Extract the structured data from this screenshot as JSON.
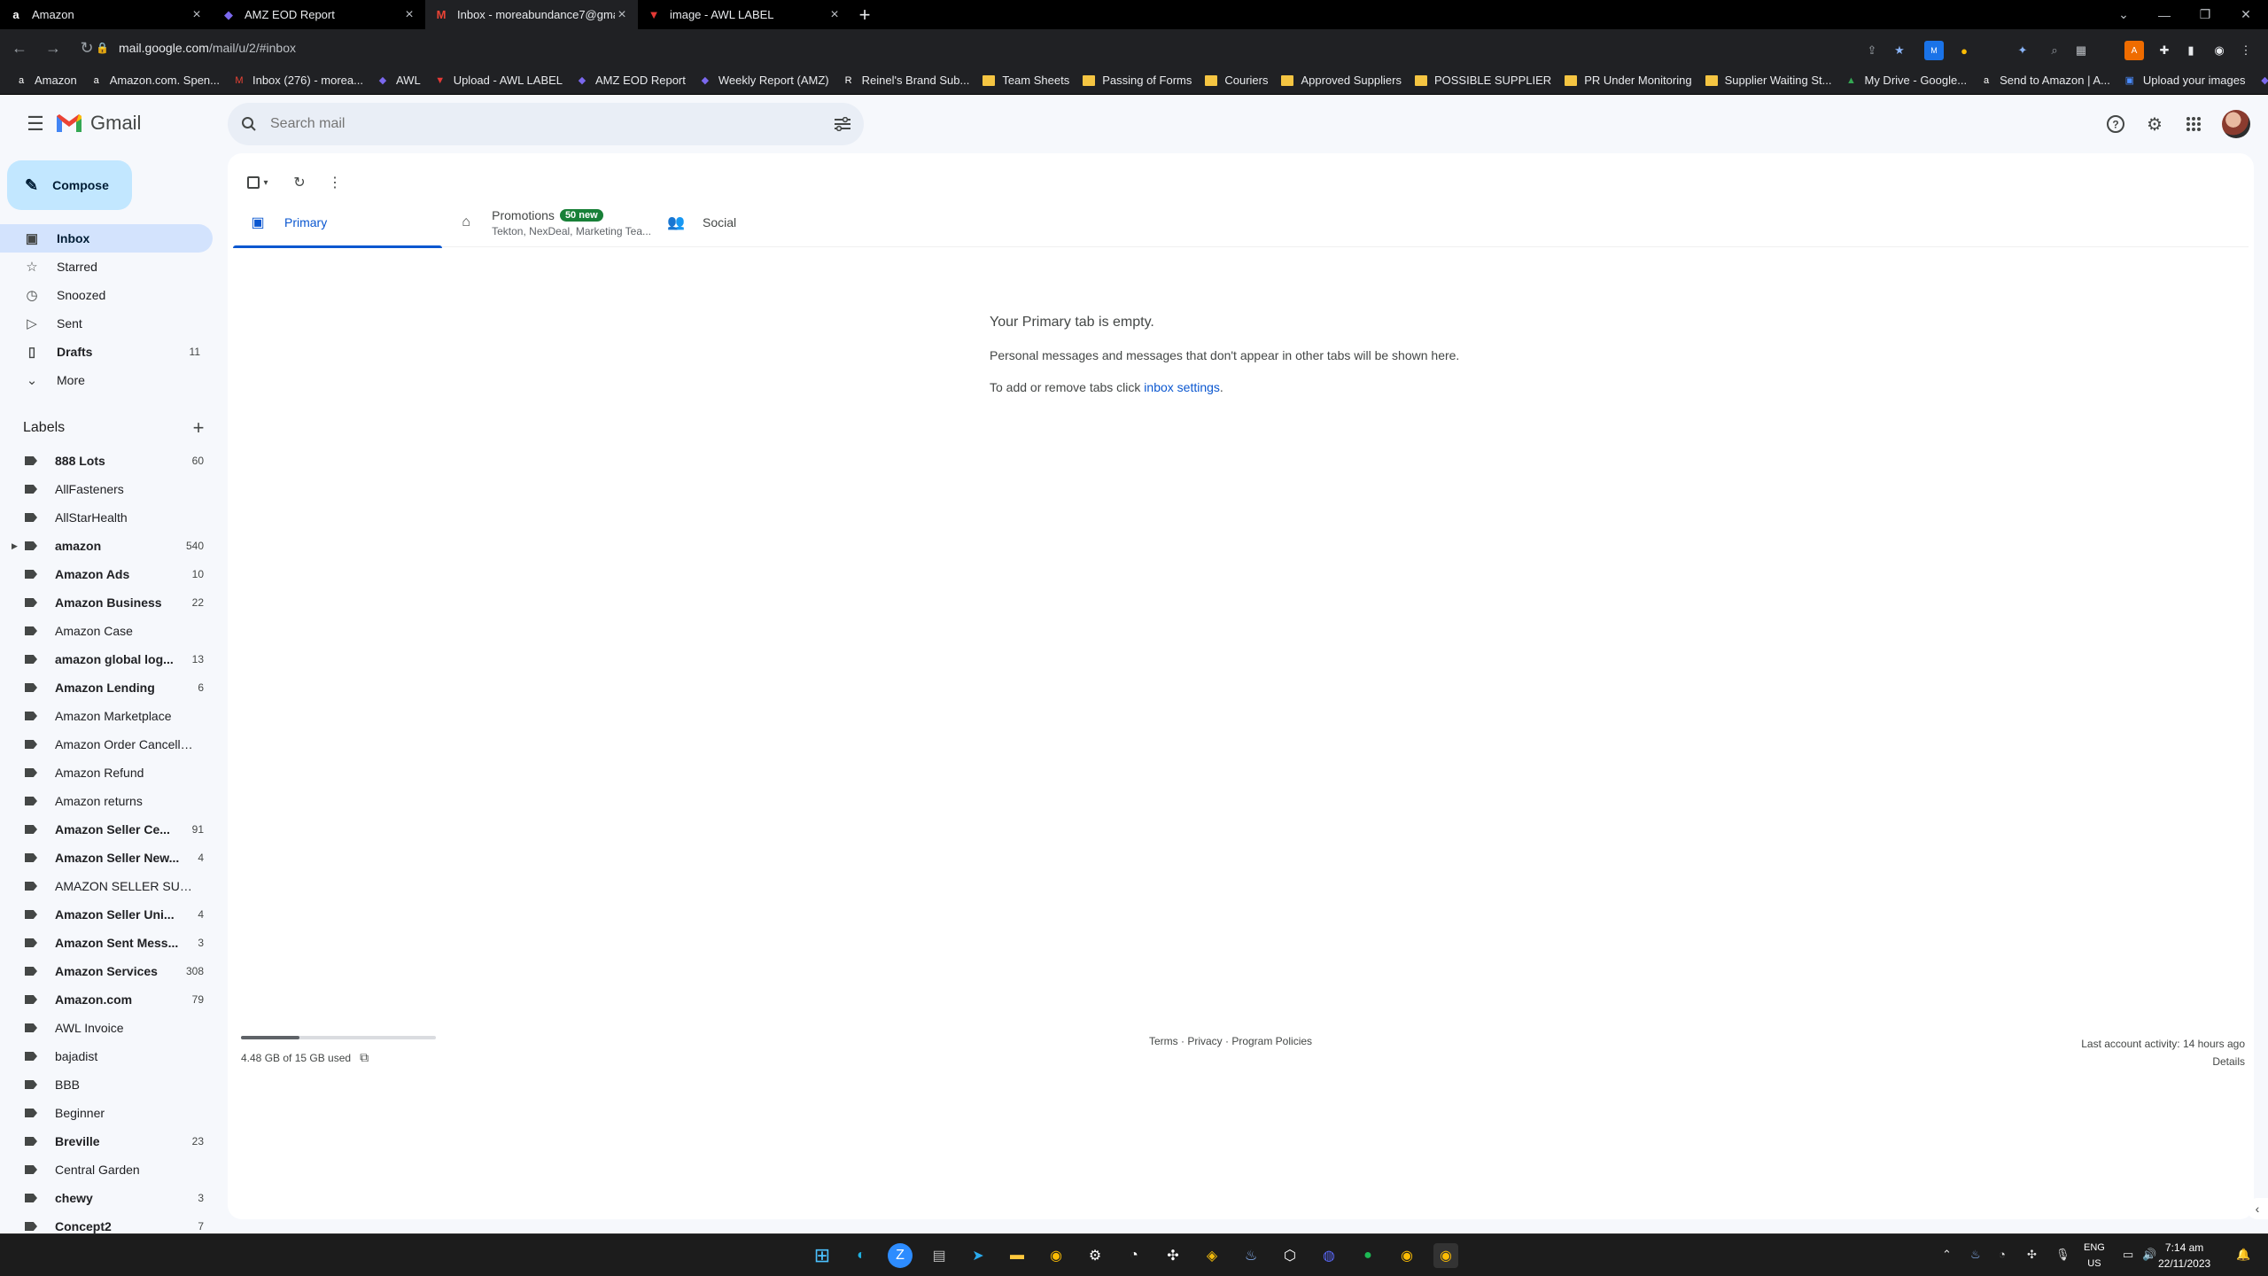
{
  "browser": {
    "tabs": [
      {
        "title": "Amazon",
        "icon": "amazon-icon"
      },
      {
        "title": "AMZ EOD Report",
        "icon": "clickup-icon"
      },
      {
        "title": "Inbox - moreabundance7@gma",
        "icon": "gmail-icon"
      },
      {
        "title": "image - AWL LABEL",
        "icon": "awl-icon"
      }
    ],
    "active_tab": 2,
    "url_domain": "mail.google.com",
    "url_path": "/mail/u/2/#inbox",
    "bookmarks": [
      "Amazon",
      "Amazon.com. Spen...",
      "Inbox (276) - morea...",
      "AWL",
      "Upload - AWL LABEL",
      "AMZ EOD Report",
      "Weekly Report (AMZ)",
      "Reinel's Brand Sub...",
      "Team Sheets",
      "Passing of Forms",
      "Couriers",
      "Approved Suppliers",
      "POSSIBLE SUPPLIER",
      "PR Under Monitoring",
      "Supplier Waiting St...",
      "My Drive - Google...",
      "Send to Amazon | A...",
      "Upload your images",
      "AWL"
    ]
  },
  "gmail": {
    "app_name": "Gmail",
    "search_placeholder": "Search mail",
    "compose_label": "Compose",
    "nav": [
      {
        "label": "Inbox",
        "count": "",
        "icon": "inbox-icon"
      },
      {
        "label": "Starred",
        "count": "",
        "icon": "star-icon"
      },
      {
        "label": "Snoozed",
        "count": "",
        "icon": "clock-icon"
      },
      {
        "label": "Sent",
        "count": "",
        "icon": "send-icon"
      },
      {
        "label": "Drafts",
        "count": "11",
        "icon": "draft-icon"
      },
      {
        "label": "More",
        "count": "",
        "icon": "chevron-down-icon"
      }
    ],
    "labels_heading": "Labels",
    "labels": [
      {
        "name": "888 Lots",
        "count": "60",
        "bold": true
      },
      {
        "name": "AllFasteners",
        "count": "",
        "bold": false
      },
      {
        "name": "AllStarHealth",
        "count": "",
        "bold": false
      },
      {
        "name": "amazon",
        "count": "540",
        "bold": true,
        "expandable": true
      },
      {
        "name": "Amazon Ads",
        "count": "10",
        "bold": true
      },
      {
        "name": "Amazon Business",
        "count": "22",
        "bold": true
      },
      {
        "name": "Amazon Case",
        "count": "",
        "bold": false
      },
      {
        "name": "amazon global log...",
        "count": "13",
        "bold": true
      },
      {
        "name": "Amazon Lending",
        "count": "6",
        "bold": true
      },
      {
        "name": "Amazon Marketplace",
        "count": "",
        "bold": false
      },
      {
        "name": "Amazon Order Cancella...",
        "count": "",
        "bold": false
      },
      {
        "name": "Amazon Refund",
        "count": "",
        "bold": false
      },
      {
        "name": "Amazon returns",
        "count": "",
        "bold": false
      },
      {
        "name": "Amazon Seller Ce...",
        "count": "91",
        "bold": true
      },
      {
        "name": "Amazon Seller New...",
        "count": "4",
        "bold": true
      },
      {
        "name": "AMAZON SELLER SUPP...",
        "count": "",
        "bold": false
      },
      {
        "name": "Amazon Seller Uni...",
        "count": "4",
        "bold": true
      },
      {
        "name": "Amazon Sent Mess...",
        "count": "3",
        "bold": true
      },
      {
        "name": "Amazon Services",
        "count": "308",
        "bold": true
      },
      {
        "name": "Amazon.com",
        "count": "79",
        "bold": true
      },
      {
        "name": "AWL Invoice",
        "count": "",
        "bold": false
      },
      {
        "name": "bajadist",
        "count": "",
        "bold": false
      },
      {
        "name": "BBB",
        "count": "",
        "bold": false
      },
      {
        "name": "Beginner",
        "count": "",
        "bold": false
      },
      {
        "name": "Breville",
        "count": "23",
        "bold": true
      },
      {
        "name": "Central Garden",
        "count": "",
        "bold": false
      },
      {
        "name": "chewy",
        "count": "3",
        "bold": true
      },
      {
        "name": "Concept2",
        "count": "7",
        "bold": true
      }
    ],
    "tabs": {
      "primary": "Primary",
      "promotions": "Promotions",
      "promotions_badge": "50 new",
      "promotions_senders": "Tekton, NexDeal, Marketing Tea...",
      "social": "Social"
    },
    "empty": {
      "heading": "Your Primary tab is empty.",
      "line1": "Personal messages and messages that don't appear in other tabs will be shown here.",
      "line2_prefix": "To add or remove tabs click ",
      "line2_link": "inbox settings",
      "line2_suffix": "."
    },
    "storage": {
      "text": "4.48 GB of 15 GB used",
      "fraction": 0.299
    },
    "footer_links": "Terms · Privacy · Program Policies",
    "activity_line1": "Last account activity: 14 hours ago",
    "activity_line2": "Details"
  },
  "taskbar": {
    "lang_1": "ENG",
    "lang_2": "US",
    "time": "7:14 am",
    "date": "22/11/2023"
  }
}
